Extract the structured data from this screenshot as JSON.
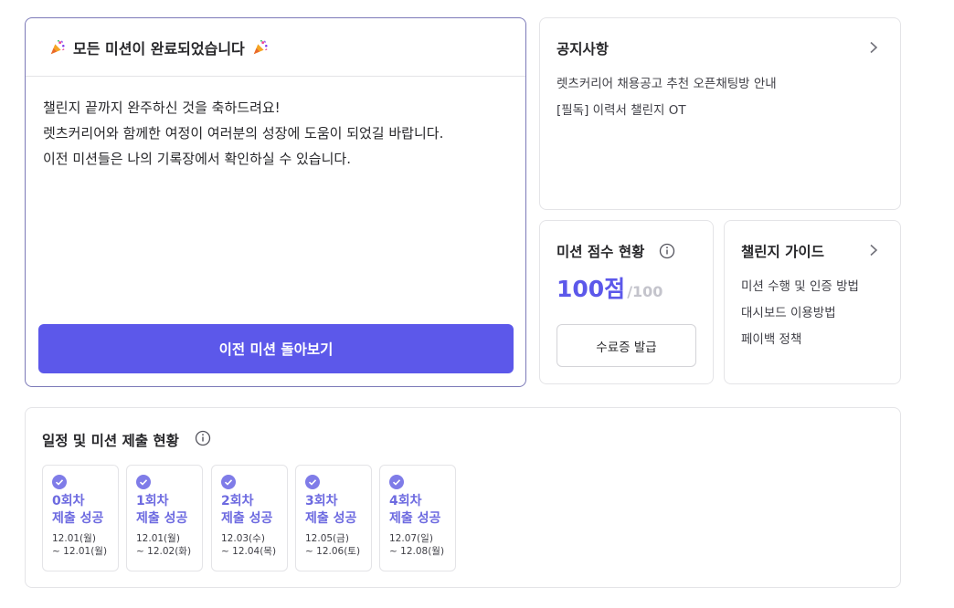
{
  "mission": {
    "title": "모든 미션이 완료되었습니다",
    "lines": [
      "챌린지 끝까지 완주하신 것을 축하드려요!",
      "렛츠커리어와 함께한 여정이 여러분의 성장에 도움이 되었길 바랍니다.",
      "이전 미션들은 나의 기록장에서 확인하실 수 있습니다."
    ],
    "button_label": "이전 미션 돌아보기"
  },
  "notice": {
    "title": "공지사항",
    "items": [
      "렛츠커리어 채용공고 추천 오픈채팅방 안내",
      "[필독] 이력서 챌린지 OT"
    ]
  },
  "score": {
    "title": "미션 점수 현황",
    "value": "100점",
    "max": "/100",
    "button_label": "수료증 발급"
  },
  "guide": {
    "title": "챌린지 가이드",
    "items": [
      "미션 수행 및 인증 방법",
      "대시보드 이용방법",
      "페이백 정책"
    ]
  },
  "schedule": {
    "title": "일정 및 미션 제출 현황",
    "rounds": [
      {
        "round": "0회차",
        "status": "제출 성공",
        "start": "12.01(월)",
        "end": "~ 12.01(월)"
      },
      {
        "round": "1회차",
        "status": "제출 성공",
        "start": "12.01(월)",
        "end": "~ 12.02(화)"
      },
      {
        "round": "2회차",
        "status": "제출 성공",
        "start": "12.03(수)",
        "end": "~ 12.04(목)"
      },
      {
        "round": "3회차",
        "status": "제출 성공",
        "start": "12.05(금)",
        "end": "~ 12.06(토)"
      },
      {
        "round": "4회차",
        "status": "제출 성공",
        "start": "12.07(일)",
        "end": "~ 12.08(월)"
      }
    ]
  },
  "colors": {
    "accent": "#5c58ea",
    "check": "#7f7ce8",
    "round_title": "#6d6ae0",
    "border": "#e4e4e7"
  },
  "icons": {
    "party": "party-popper-icon",
    "chevron": "chevron-right-icon",
    "info": "info-icon",
    "check": "check-circle-icon"
  }
}
